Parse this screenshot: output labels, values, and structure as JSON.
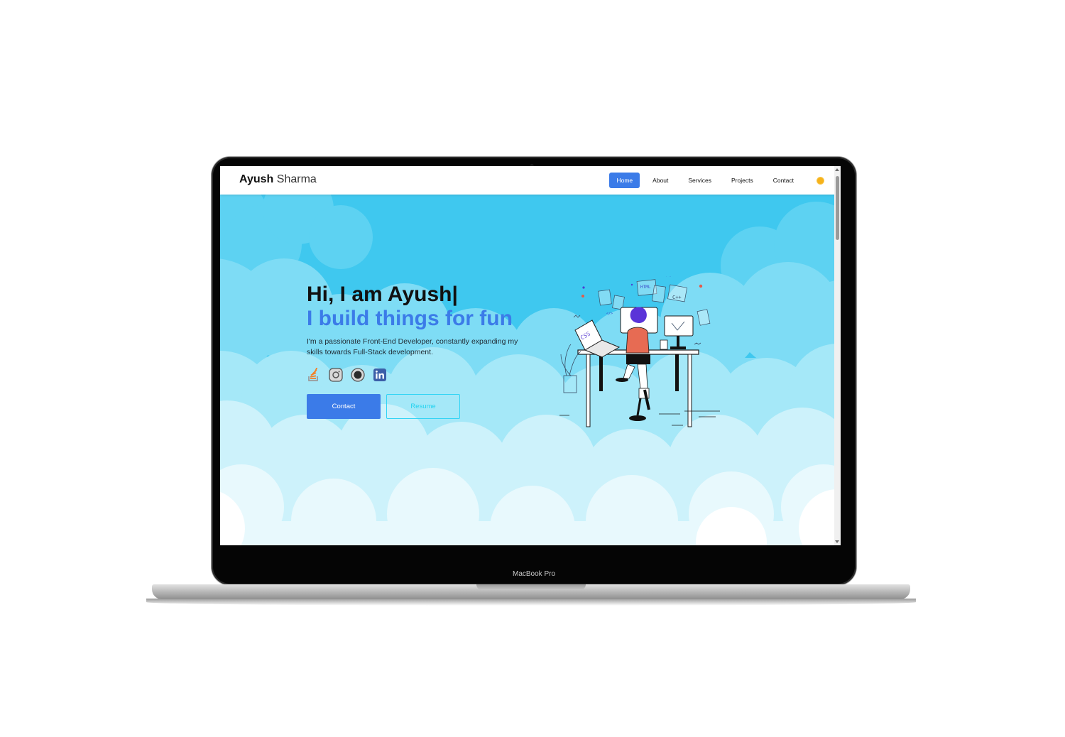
{
  "device": {
    "label": "MacBook Pro"
  },
  "navbar": {
    "brand_first": "Ayush",
    "brand_last": "Sharma",
    "links": [
      {
        "label": "Home",
        "active": true
      },
      {
        "label": "About"
      },
      {
        "label": "Services"
      },
      {
        "label": "Projects"
      },
      {
        "label": "Contact"
      }
    ],
    "theme_toggle_color": "#f6b21a"
  },
  "hero": {
    "greeting": "Hi, I am Ayush|",
    "tagline": "I build things for fun",
    "intro": "I'm a passionate Front-End Developer, constantly expanding my skills towards Full-Stack development.",
    "socials": [
      "stack-overflow-icon",
      "instagram-icon",
      "github-icon",
      "linkedin-icon"
    ],
    "buttons": {
      "contact": "Contact",
      "resume": "Resume"
    },
    "illustration_text": {
      "css": "CSS",
      "html": "HTML",
      "cpp": "C++",
      "tag": "</>"
    }
  },
  "colors": {
    "accent": "#3b7be8",
    "sky": "#39c3ee",
    "resume_outline": "#33d4f5"
  }
}
